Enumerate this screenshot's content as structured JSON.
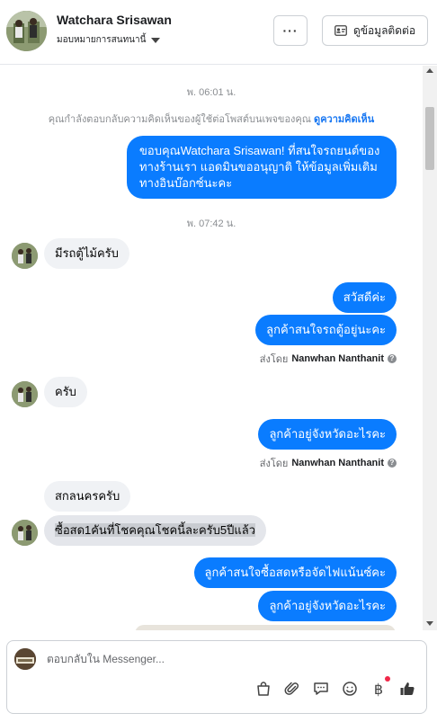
{
  "header": {
    "contact_name": "Watchara Srisawan",
    "assign_label": "มอบหมายการสนทนานี้",
    "more_label": "···",
    "view_details_label": "ดูข้อมูลติดต่อ"
  },
  "chat": {
    "timestamp_1": "พ. 06:01 น.",
    "context_text": "คุณกำลังตอบกลับความคิดเห็นของผู้ใช้ต่อโพสต์บนเพจของคุณ",
    "context_link": "ดูความคิดเห็น",
    "msg_welcome": "ขอบคุณWatchara Srisawan! ที่สนใจรถยนต์ของทางร้านเรา แอดมินขออนุญาติ ให้ข้อมูลเพิ่มเติมทางอินบ๊อกซ์นะคะ",
    "timestamp_2": "พ. 07:42 น.",
    "msg_in_1": "มีรถตู้ไม้ครับ",
    "msg_out_1": "สวัสดีค่ะ",
    "msg_out_2": "ลูกค้าสนใจรถตู้อยู่นะคะ",
    "sent_by_label": "ส่งโดย",
    "sent_by_name": "Nanwhan Nanthanit",
    "msg_in_2": "ครับ",
    "msg_out_3": "ลูกค้าอยู่จังหวัดอะไรคะ",
    "msg_in_3": "สกลนครครับ",
    "msg_in_4": "ซื้อสด1คันที่โชคคุณโชคนี้ละครับ5ปีแล้ว",
    "msg_out_4": "ลูกค้าสนใจซื้อสดหรือจัดไฟแน้นซ์คะ",
    "msg_out_5": "ลูกค้าอยู่จังหวัดอะไรคะ"
  },
  "composer": {
    "placeholder": "ตอบกลับใน Messenger...",
    "baht_symbol": "฿"
  },
  "colors": {
    "outgoing_bubble": "#0a7cff",
    "incoming_bubble": "#f0f2f5",
    "link": "#1877f2"
  }
}
